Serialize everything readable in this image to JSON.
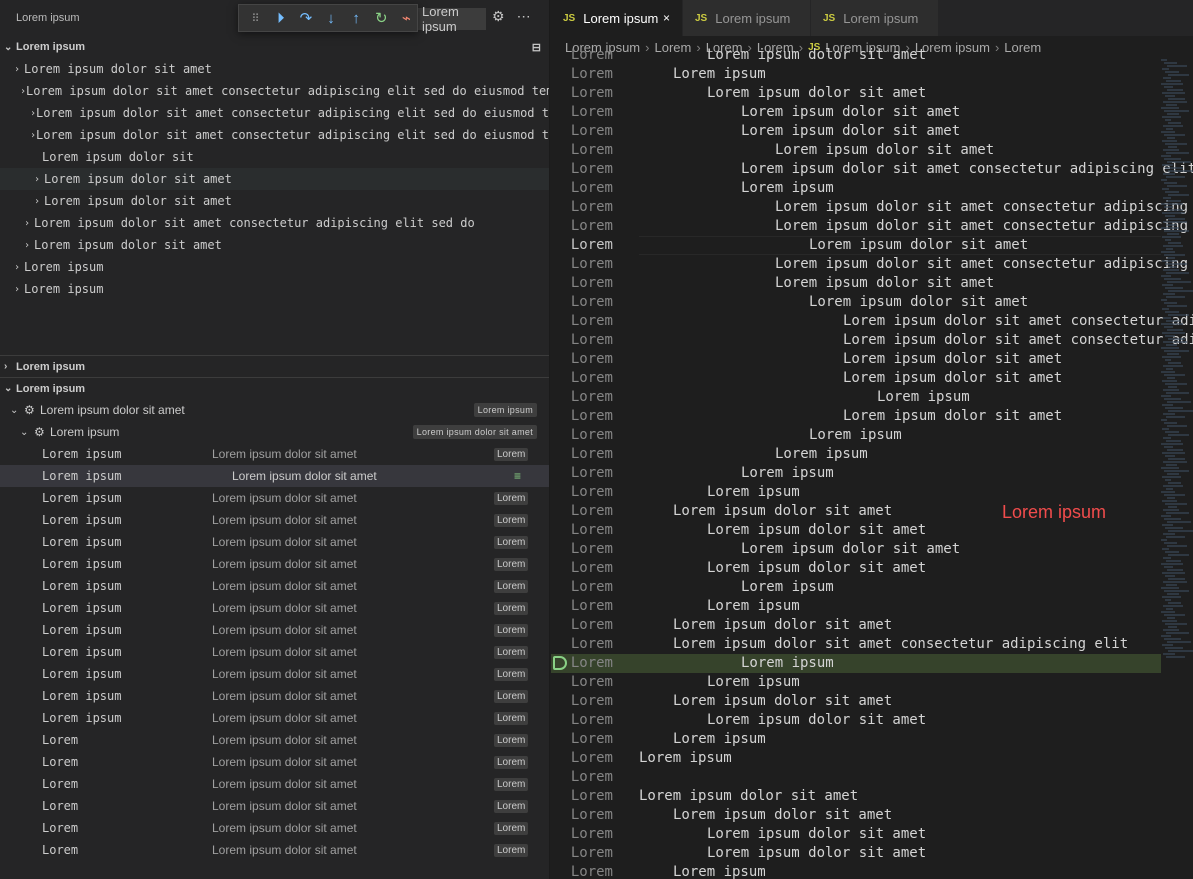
{
  "sidebar": {
    "title": "Lorem ipsum",
    "launch_config": "Lorem ipsum",
    "variables": {
      "heading": "Lorem ipsum",
      "rows": [
        "Lorem ipsum dolor sit amet",
        "Lorem ipsum dolor sit amet consectetur adipiscing elit sed do eiusmod tempor",
        "Lorem ipsum dolor sit amet consectetur adipiscing elit sed do eiusmod tempor",
        "Lorem ipsum dolor sit amet consectetur adipiscing elit sed do eiusmod tempor",
        "Lorem ipsum dolor sit",
        "Lorem ipsum dolor sit amet",
        "Lorem ipsum dolor sit amet",
        "Lorem ipsum dolor sit amet consectetur adipiscing elit sed do",
        "Lorem ipsum dolor sit amet",
        "Lorem ipsum",
        "Lorem ipsum"
      ]
    },
    "watch_heading": "Lorem ipsum",
    "call_stack": {
      "heading": "Lorem ipsum",
      "process": "Lorem ipsum dolor sit amet",
      "process_badge": "Lorem ipsum",
      "thread": "Lorem ipsum",
      "thread_badge": "Lorem ipsum dolor sit amet",
      "frames": [
        {
          "fn": "Lorem ipsum",
          "path": "Lorem ipsum dolor sit amet",
          "line": "Lorem"
        },
        {
          "fn": "Lorem ipsum",
          "path": "Lorem ipsum dolor sit amet",
          "line": ""
        },
        {
          "fn": "Lorem ipsum",
          "path": "Lorem ipsum dolor sit amet",
          "line": "Lorem"
        },
        {
          "fn": "Lorem ipsum",
          "path": "Lorem ipsum dolor sit amet",
          "line": "Lorem"
        },
        {
          "fn": "Lorem ipsum",
          "path": "Lorem ipsum dolor sit amet",
          "line": "Lorem"
        },
        {
          "fn": "Lorem ipsum",
          "path": "Lorem ipsum dolor sit amet",
          "line": "Lorem"
        },
        {
          "fn": "Lorem ipsum",
          "path": "Lorem ipsum dolor sit amet",
          "line": "Lorem"
        },
        {
          "fn": "Lorem ipsum",
          "path": "Lorem ipsum dolor sit amet",
          "line": "Lorem"
        },
        {
          "fn": "Lorem ipsum",
          "path": "Lorem ipsum dolor sit amet",
          "line": "Lorem"
        },
        {
          "fn": "Lorem ipsum",
          "path": "Lorem ipsum dolor sit amet",
          "line": "Lorem"
        },
        {
          "fn": "Lorem ipsum",
          "path": "Lorem ipsum dolor sit amet",
          "line": "Lorem"
        },
        {
          "fn": "Lorem ipsum",
          "path": "Lorem ipsum dolor sit amet",
          "line": "Lorem"
        },
        {
          "fn": "Lorem ipsum",
          "path": "Lorem ipsum dolor sit amet",
          "line": "Lorem"
        },
        {
          "fn": "Lorem",
          "path": "Lorem ipsum dolor sit amet",
          "line": "Lorem"
        },
        {
          "fn": "Lorem",
          "path": "Lorem ipsum dolor sit amet",
          "line": "Lorem"
        },
        {
          "fn": "Lorem",
          "path": "Lorem ipsum dolor sit amet",
          "line": "Lorem"
        },
        {
          "fn": "Lorem",
          "path": "Lorem ipsum dolor sit amet",
          "line": "Lorem"
        },
        {
          "fn": "Lorem",
          "path": "Lorem ipsum dolor sit amet",
          "line": "Lorem"
        },
        {
          "fn": "Lorem",
          "path": "Lorem ipsum dolor sit amet",
          "line": "Lorem"
        }
      ]
    }
  },
  "editor": {
    "tabs": [
      {
        "label": "Lorem ipsum",
        "icon": "JS"
      },
      {
        "label": "Lorem ipsum",
        "icon": "JS"
      },
      {
        "label": "Lorem ipsum",
        "icon": "JS"
      }
    ],
    "breadcrumbs": [
      "Lorem ipsum",
      "Lorem",
      "Lorem",
      "Lorem",
      "Lorem ipsum",
      "Lorem ipsum",
      "Lorem"
    ],
    "lines": [
      {
        "n": "Lorem",
        "t": "Lorem ipsum dolor sit amet"
      },
      {
        "n": "Lorem",
        "t": "Lorem ipsum"
      },
      {
        "n": "Lorem",
        "t": "Lorem ipsum dolor sit amet"
      },
      {
        "n": "Lorem",
        "t": "Lorem ipsum dolor sit amet"
      },
      {
        "n": "Lorem",
        "t": "Lorem ipsum dolor sit amet"
      },
      {
        "n": "Lorem",
        "t": "Lorem ipsum dolor sit amet"
      },
      {
        "n": "Lorem",
        "t": "Lorem ipsum dolor sit amet consectetur adipiscing elit"
      },
      {
        "n": "Lorem",
        "t": "Lorem ipsum"
      },
      {
        "n": "Lorem",
        "t": "Lorem ipsum dolor sit amet consectetur adipiscing elit"
      },
      {
        "n": "Lorem",
        "t": "Lorem ipsum dolor sit amet consectetur adipiscing elit"
      },
      {
        "n": "Lorem",
        "t": "Lorem ipsum dolor sit amet"
      },
      {
        "n": "Lorem",
        "t": "Lorem ipsum dolor sit amet consectetur adipiscing elit"
      },
      {
        "n": "Lorem",
        "t": "Lorem ipsum dolor sit amet"
      },
      {
        "n": "Lorem",
        "t": "Lorem ipsum dolor sit amet"
      },
      {
        "n": "Lorem",
        "t": "Lorem ipsum dolor sit amet consectetur adipiscing elit"
      },
      {
        "n": "Lorem",
        "t": "Lorem ipsum dolor sit amet consectetur adipiscing elit"
      },
      {
        "n": "Lorem",
        "t": "Lorem ipsum dolor sit amet"
      },
      {
        "n": "Lorem",
        "t": "Lorem ipsum dolor sit amet"
      },
      {
        "n": "Lorem",
        "t": "Lorem ipsum"
      },
      {
        "n": "Lorem",
        "t": "Lorem ipsum dolor sit amet"
      },
      {
        "n": "Lorem",
        "t": "Lorem ipsum"
      },
      {
        "n": "Lorem",
        "t": "Lorem ipsum"
      },
      {
        "n": "Lorem",
        "t": "Lorem ipsum"
      },
      {
        "n": "Lorem",
        "t": "Lorem ipsum"
      },
      {
        "n": "Lorem",
        "t": "Lorem ipsum dolor sit amet"
      },
      {
        "n": "Lorem",
        "t": "Lorem ipsum dolor sit amet"
      },
      {
        "n": "Lorem",
        "t": "Lorem ipsum dolor sit amet"
      },
      {
        "n": "Lorem",
        "t": "Lorem ipsum dolor sit amet"
      },
      {
        "n": "Lorem",
        "t": "Lorem ipsum"
      },
      {
        "n": "Lorem",
        "t": "Lorem ipsum"
      },
      {
        "n": "Lorem",
        "t": "Lorem ipsum dolor sit amet"
      },
      {
        "n": "Lorem",
        "t": "Lorem ipsum dolor sit amet consectetur adipiscing elit"
      },
      {
        "n": "Lorem",
        "t": "Lorem ipsum"
      },
      {
        "n": "Lorem",
        "t": "Lorem ipsum"
      },
      {
        "n": "Lorem",
        "t": "Lorem ipsum dolor sit amet"
      },
      {
        "n": "Lorem",
        "t": "Lorem ipsum dolor sit amet"
      },
      {
        "n": "Lorem",
        "t": "Lorem ipsum"
      },
      {
        "n": "Lorem",
        "t": "Lorem ipsum"
      },
      {
        "n": "Lorem",
        "t": ""
      },
      {
        "n": "Lorem",
        "t": "Lorem ipsum dolor sit amet"
      },
      {
        "n": "Lorem",
        "t": "Lorem ipsum dolor sit amet"
      },
      {
        "n": "Lorem",
        "t": "Lorem ipsum dolor sit amet"
      },
      {
        "n": "Lorem",
        "t": "Lorem ipsum dolor sit amet"
      },
      {
        "n": "Lorem",
        "t": "Lorem ipsum"
      }
    ],
    "paused_line_index": 32,
    "cursor_line_index": 10,
    "annotation": "Lorem ipsum"
  }
}
